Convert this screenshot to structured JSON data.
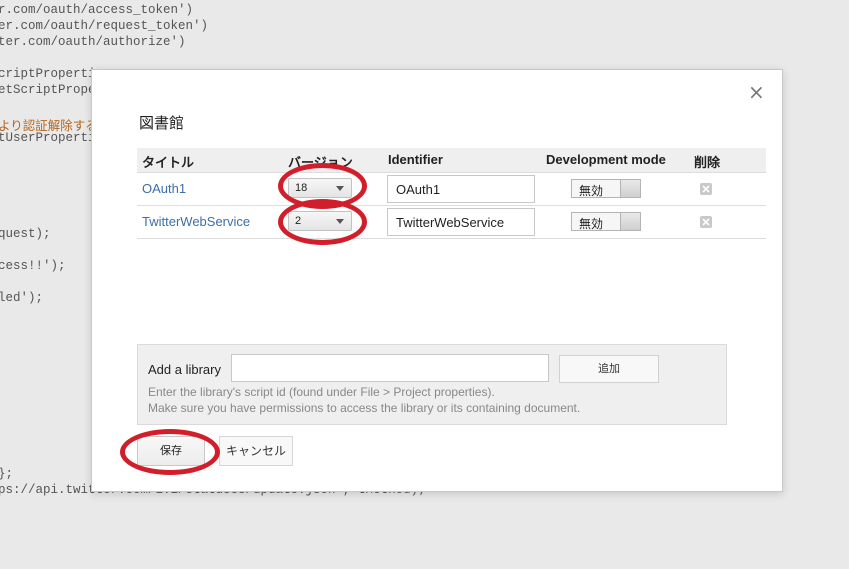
{
  "code_bg": {
    "lines": [
      "r.com/oauth/access_token')",
      "er.com/oauth/request_token')",
      "ter.com/oauth/authorize')",
      "criptPropertie",
      "etScriptPrope",
      "より認証解除する",
      "tUserPropertie",
      "quest);",
      "cess!!');",
      "led');",
      "};",
      "ps://api.twitter.com/1.1/statuses/update.json', tMethod);"
    ]
  },
  "dialog": {
    "title": "図書館",
    "close_icon": "close-icon",
    "table": {
      "headers": {
        "title": "タイトル",
        "version": "バージョン",
        "identifier": "Identifier",
        "dev_mode": "Development mode",
        "delete": "削除"
      },
      "rows": [
        {
          "title": "OAuth1",
          "version": "18",
          "identifier": "OAuth1",
          "dev_mode": "無効"
        },
        {
          "title": "TwitterWebService",
          "version": "2",
          "identifier": "TwitterWebService",
          "dev_mode": "無効"
        }
      ]
    },
    "add_library": {
      "label": "Add a library",
      "input_value": "",
      "button": "追加",
      "help_line1": "Enter the library's script id (found under File > Project properties).",
      "help_line2": "Make sure you have permissions to access the library or its containing document."
    },
    "save": "保存",
    "cancel": "キャンセル"
  },
  "colors": {
    "link": "#3d6ea8",
    "annotation": "#d21e2a"
  }
}
